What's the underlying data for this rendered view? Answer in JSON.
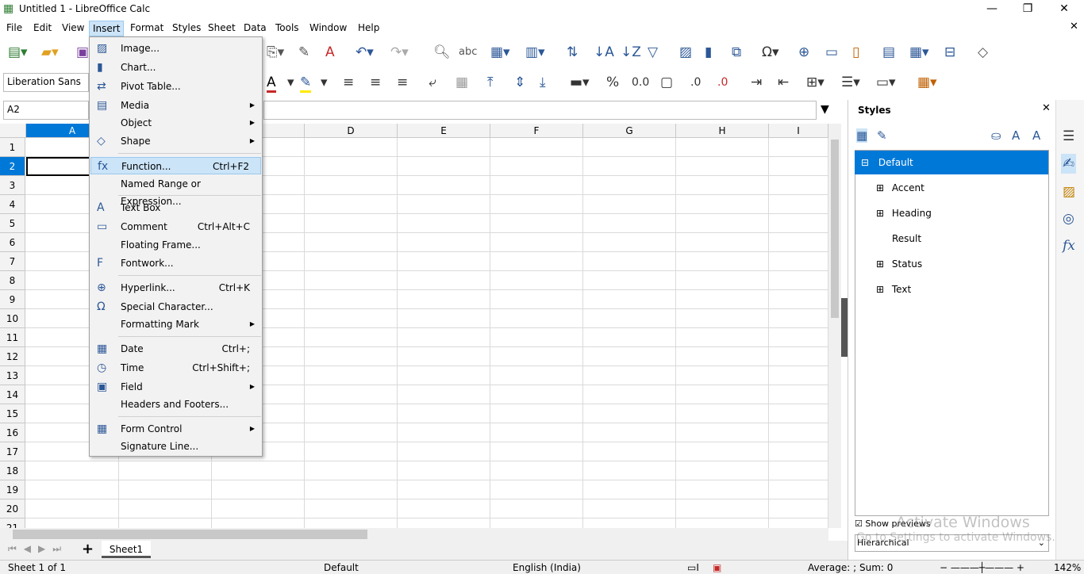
{
  "window": {
    "title": "Untitled 1 - LibreOffice Calc"
  },
  "menubar": [
    "File",
    "Edit",
    "View",
    "Insert",
    "Format",
    "Styles",
    "Sheet",
    "Data",
    "Tools",
    "Window",
    "Help"
  ],
  "toolbar": {
    "font_name": "Liberation Sans",
    "name_box": "A2"
  },
  "columns": [
    "A",
    "B",
    "C",
    "D",
    "E",
    "F",
    "G",
    "H",
    "I"
  ],
  "rows": [
    "1",
    "2",
    "3",
    "4",
    "5",
    "6",
    "7",
    "8",
    "9",
    "10",
    "11",
    "12",
    "13",
    "14",
    "15",
    "16",
    "17",
    "18",
    "19",
    "20",
    "21"
  ],
  "insert_menu": [
    {
      "label": "Image...",
      "icon": "image-icon",
      "shortcut": "",
      "sub": false
    },
    {
      "label": "Chart...",
      "icon": "chart-icon",
      "shortcut": "",
      "sub": false
    },
    {
      "label": "Pivot Table...",
      "icon": "pivot-icon",
      "shortcut": "",
      "sub": false
    },
    {
      "label": "Media",
      "icon": "media-icon",
      "shortcut": "",
      "sub": true
    },
    {
      "label": "Object",
      "icon": "",
      "shortcut": "",
      "sub": true
    },
    {
      "label": "Shape",
      "icon": "shape-icon",
      "shortcut": "",
      "sub": true
    },
    {
      "label": "Function...",
      "icon": "function-icon",
      "shortcut": "Ctrl+F2",
      "sub": false
    },
    {
      "label": "Named Range or Expression...",
      "icon": "",
      "shortcut": "",
      "sub": false
    },
    {
      "label": "Text Box",
      "icon": "textbox-icon",
      "shortcut": "",
      "sub": false
    },
    {
      "label": "Comment",
      "icon": "comment-icon",
      "shortcut": "Ctrl+Alt+C",
      "sub": false
    },
    {
      "label": "Floating Frame...",
      "icon": "",
      "shortcut": "",
      "sub": false
    },
    {
      "label": "Fontwork...",
      "icon": "fontwork-icon",
      "shortcut": "",
      "sub": false
    },
    {
      "label": "Hyperlink...",
      "icon": "hyperlink-icon",
      "shortcut": "Ctrl+K",
      "sub": false
    },
    {
      "label": "Special Character...",
      "icon": "omega-icon",
      "shortcut": "",
      "sub": false
    },
    {
      "label": "Formatting Mark",
      "icon": "",
      "shortcut": "",
      "sub": true
    },
    {
      "label": "Date",
      "icon": "calendar-icon",
      "shortcut": "Ctrl+;",
      "sub": false
    },
    {
      "label": "Time",
      "icon": "clock-icon",
      "shortcut": "Ctrl+Shift+;",
      "sub": false
    },
    {
      "label": "Field",
      "icon": "field-icon",
      "shortcut": "",
      "sub": true
    },
    {
      "label": "Headers and Footers...",
      "icon": "",
      "shortcut": "",
      "sub": false
    },
    {
      "label": "Form Control",
      "icon": "form-control-icon",
      "shortcut": "",
      "sub": true
    },
    {
      "label": "Signature Line...",
      "icon": "",
      "shortcut": "",
      "sub": false
    }
  ],
  "sidebar": {
    "title": "Styles",
    "styles": [
      "Default",
      "Accent",
      "Heading",
      "Result",
      "Status",
      "Text"
    ],
    "show_previews": "Show previews",
    "filter": "Hierarchical"
  },
  "watermark": {
    "line1": "Activate Windows",
    "line2": "Go to Settings to activate Windows."
  },
  "sheet_tab": "Sheet1",
  "status": {
    "sheet": "Sheet 1 of 1",
    "style": "Default",
    "language": "English (India)",
    "sum": "Average: ; Sum: 0",
    "zoom": "142%"
  },
  "colors": {
    "accent": "#0078d7",
    "selected_style_bg": "#0078d7"
  }
}
